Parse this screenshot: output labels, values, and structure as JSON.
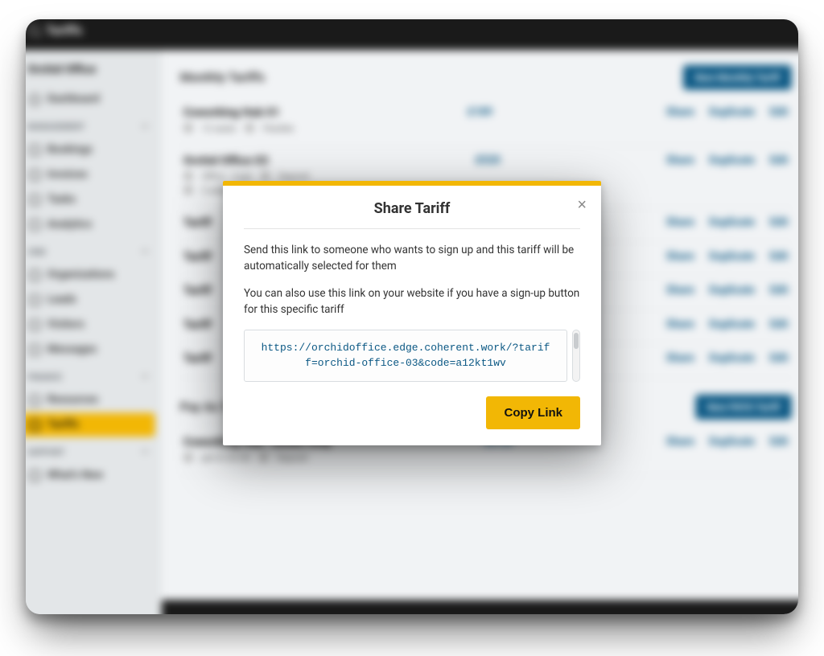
{
  "topbar": {
    "title": "Tariffs"
  },
  "brand": "Orchid Office",
  "sidebar": {
    "dashboard": "Dashboard",
    "groups": [
      {
        "label": "MANAGEMENT",
        "items": [
          {
            "label": "Bookings"
          },
          {
            "label": "Invoices"
          },
          {
            "label": "Tasks"
          },
          {
            "label": "Analytics"
          }
        ]
      },
      {
        "label": "CRM",
        "items": [
          {
            "label": "Organizations"
          },
          {
            "label": "Leads"
          },
          {
            "label": "Visitors"
          },
          {
            "label": "Messages"
          }
        ]
      },
      {
        "label": "FINANCE",
        "items": [
          {
            "label": "Resources"
          },
          {
            "label": "Tariffs",
            "active": true
          }
        ]
      },
      {
        "label": "SUPPORT",
        "items": [
          {
            "label": "What's New"
          }
        ]
      }
    ]
  },
  "sections": [
    {
      "title": "Monthly Tariffs",
      "button": "New Monthly Tariff",
      "rows": [
        {
          "name": "Coworking Hub 01",
          "meta1": "12 seats",
          "meta2": "Flexible",
          "price": "£189",
          "a1": "Share",
          "a2": "Duplicate",
          "a3": "Edit"
        },
        {
          "name": "Orchid Office 03",
          "meta1": "Office · 4 ppl",
          "meta2": "Deposit",
          "price": "£520",
          "a1": "Share",
          "a2": "Duplicate",
          "a3": "Edit",
          "extra": "3 addons"
        },
        {
          "name": "Tariff",
          "meta1": "",
          "meta2": "",
          "price": "",
          "a1": "Share",
          "a2": "Duplicate",
          "a3": "Edit"
        },
        {
          "name": "Tariff",
          "meta1": "",
          "meta2": "",
          "price": "",
          "a1": "Share",
          "a2": "Duplicate",
          "a3": "Edit"
        },
        {
          "name": "Tariff",
          "meta1": "",
          "meta2": "",
          "price": "",
          "a1": "Share",
          "a2": "Duplicate",
          "a3": "Edit"
        },
        {
          "name": "Tariff",
          "meta1": "",
          "meta2": "",
          "price": "",
          "a1": "Share",
          "a2": "Duplicate",
          "a3": "Edit"
        },
        {
          "name": "Tariff",
          "meta1": "",
          "meta2": "",
          "price": "",
          "a1": "Share",
          "a2": "Duplicate",
          "a3": "Edit"
        }
      ]
    },
    {
      "title": "Pay As You Go Tariffs",
      "button": "New PAYG Tariff",
      "rows": [
        {
          "name": "Coworking Hub · Desks Only",
          "meta1": "per hr £4.50",
          "meta2": "Deposit",
          "price": "£4.50",
          "a1": "Share",
          "a2": "Duplicate",
          "a3": "Edit"
        }
      ]
    }
  ],
  "modal": {
    "title": "Share Tariff",
    "text1": "Send this link to someone who wants to sign up and this tariff will be automatically selected for them",
    "text2": "You can also use this link on your website if you have a sign-up button for this specific tariff",
    "link": "https://orchidoffice.edge.coherent.work/?tariff=orchid-office-03&code=a12kt1wv",
    "copy": "Copy Link",
    "close": "×"
  }
}
